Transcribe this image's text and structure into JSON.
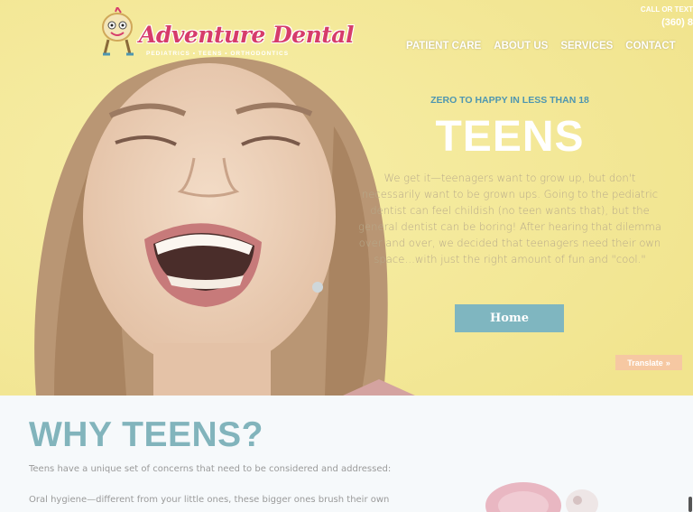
{
  "header": {
    "logo_text": "Adventure Dental",
    "logo_tagline": "PEDIATRICS • TEENS • ORTHODONTICS",
    "call_label": "CALL OR TEXT",
    "call_phone": "(360) 8"
  },
  "nav": {
    "items": [
      {
        "label": "PATIENT CARE"
      },
      {
        "label": "ABOUT US"
      },
      {
        "label": "SERVICES"
      },
      {
        "label": "CONTACT"
      }
    ]
  },
  "hero": {
    "eyebrow": "ZERO TO HAPPY IN LESS THAN 18",
    "title": "TEENS",
    "body": "We get it—teenagers want to grow up, but don't necessarily want to be grown ups. Going to the pediatric dentist can feel childish (no teen wants that), but the general dentist can be boring! After hearing that dilemma over and over, we decided that teenagers need their own space…with just the right amount of fun and \"cool.\"",
    "home_label": "Home",
    "translate_label": "Translate",
    "translate_arrow": "»"
  },
  "why": {
    "title": "WHY TEENS?",
    "p1": "Teens have a unique set of concerns that need to be considered and addressed:",
    "p2": "Oral hygiene—different from your little ones, these bigger ones brush their own"
  },
  "colors": {
    "accent_teal": "#7fb6c0",
    "title_teal": "#82b4bc",
    "logo_pink": "#d63c6b",
    "hero_yellow": "#f4e79a"
  },
  "icons": {
    "logo_mascot": "tooth-mascot-icon",
    "translate": "double-chevron-right-icon"
  }
}
